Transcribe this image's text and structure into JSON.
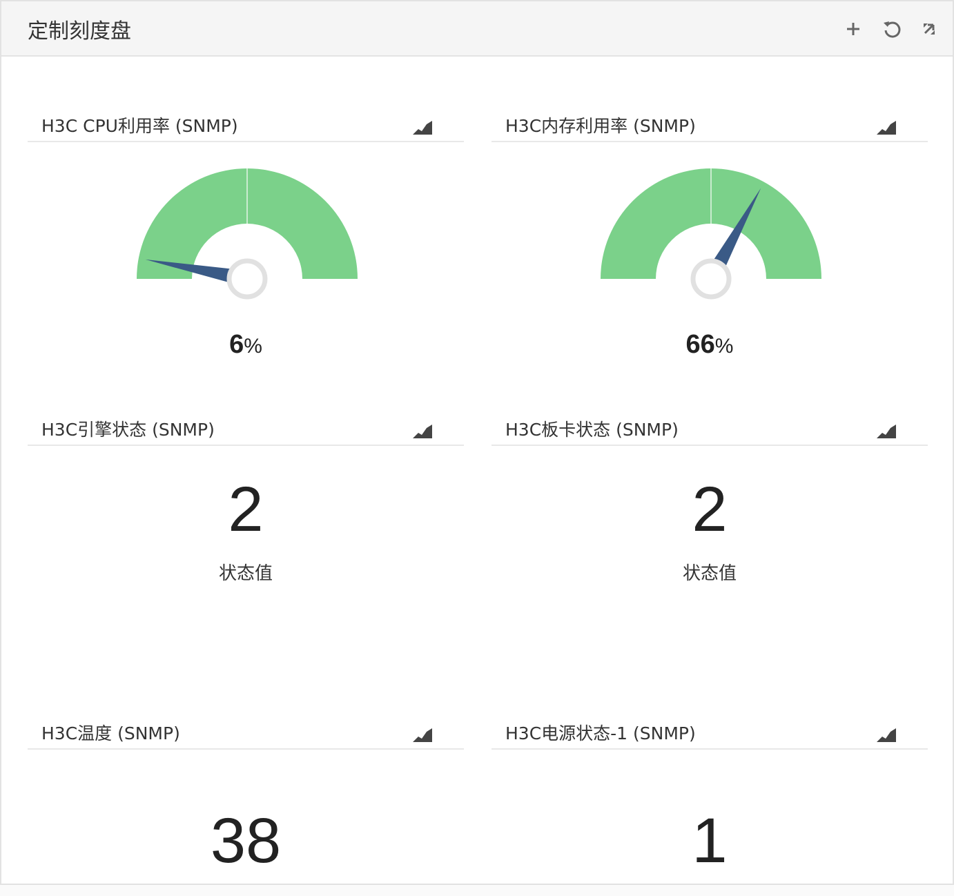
{
  "header": {
    "title": "定制刻度盘",
    "icons": [
      "plus-icon",
      "refresh-icon",
      "collapse-icon"
    ]
  },
  "colors": {
    "gauge_fill": "#7bd18a",
    "needle": "#3a5a86",
    "pivot": "#e1e1e1"
  },
  "widgets": {
    "cpu": {
      "title": "H3C CPU利用率 (SNMP)",
      "value": "6",
      "unit": "%",
      "percent": 6
    },
    "memory": {
      "title": "H3C内存利用率 (SNMP)",
      "value": "66",
      "unit": "%",
      "percent": 66
    },
    "engine": {
      "title": "H3C引擎状态 (SNMP)",
      "value": "2",
      "label": "状态值"
    },
    "board": {
      "title": "H3C板卡状态 (SNMP)",
      "value": "2",
      "label": "状态值"
    },
    "temperature": {
      "title": "H3C温度 (SNMP)",
      "value": "38"
    },
    "power": {
      "title": "H3C电源状态-1 (SNMP)",
      "value": "1"
    }
  }
}
